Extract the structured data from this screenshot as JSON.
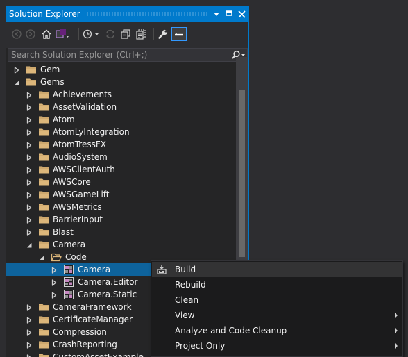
{
  "window": {
    "title": "Solution Explorer",
    "accent": "#007acc",
    "background": "#2d2d30"
  },
  "title_buttons": [
    {
      "name": "window-position-dropdown",
      "icon": "triangle-down-icon"
    },
    {
      "name": "pin-button",
      "icon": "pin-icon"
    },
    {
      "name": "close-button",
      "icon": "close-icon"
    }
  ],
  "toolbar": {
    "items": [
      "back-icon",
      "forward-icon",
      "home-icon",
      "switch-views-icon",
      "pending-changes-filter-icon",
      "sync-with-active-document-icon",
      "collapse-all-icon",
      "show-all-files-icon",
      "properties-icon",
      "preview-selected-items-icon"
    ]
  },
  "search": {
    "placeholder": "Search Solution Explorer (Ctrl+;)",
    "value": ""
  },
  "tree": [
    {
      "label": "Gem",
      "level": 0,
      "expanded": false,
      "type": "folder"
    },
    {
      "label": "Gems",
      "level": 0,
      "expanded": true,
      "type": "folder"
    },
    {
      "label": "Achievements",
      "level": 1,
      "expanded": false,
      "type": "folder"
    },
    {
      "label": "AssetValidation",
      "level": 1,
      "expanded": false,
      "type": "folder"
    },
    {
      "label": "Atom",
      "level": 1,
      "expanded": false,
      "type": "folder"
    },
    {
      "label": "AtomLyIntegration",
      "level": 1,
      "expanded": false,
      "type": "folder"
    },
    {
      "label": "AtomTressFX",
      "level": 1,
      "expanded": false,
      "type": "folder"
    },
    {
      "label": "AudioSystem",
      "level": 1,
      "expanded": false,
      "type": "folder"
    },
    {
      "label": "AWSClientAuth",
      "level": 1,
      "expanded": false,
      "type": "folder"
    },
    {
      "label": "AWSCore",
      "level": 1,
      "expanded": false,
      "type": "folder"
    },
    {
      "label": "AWSGameLift",
      "level": 1,
      "expanded": false,
      "type": "folder"
    },
    {
      "label": "AWSMetrics",
      "level": 1,
      "expanded": false,
      "type": "folder"
    },
    {
      "label": "BarrierInput",
      "level": 1,
      "expanded": false,
      "type": "folder"
    },
    {
      "label": "Blast",
      "level": 1,
      "expanded": false,
      "type": "folder"
    },
    {
      "label": "Camera",
      "level": 1,
      "expanded": true,
      "type": "folder"
    },
    {
      "label": "Code",
      "level": 2,
      "expanded": true,
      "type": "folder-open"
    },
    {
      "label": "Camera",
      "level": 3,
      "expanded": false,
      "type": "project",
      "selected": true
    },
    {
      "label": "Camera.Editor",
      "level": 3,
      "expanded": false,
      "type": "project"
    },
    {
      "label": "Camera.Static",
      "level": 3,
      "expanded": false,
      "type": "project"
    },
    {
      "label": "CameraFramework",
      "level": 1,
      "expanded": false,
      "type": "folder"
    },
    {
      "label": "CertificateManager",
      "level": 1,
      "expanded": false,
      "type": "folder"
    },
    {
      "label": "Compression",
      "level": 1,
      "expanded": false,
      "type": "folder"
    },
    {
      "label": "CrashReporting",
      "level": 1,
      "expanded": false,
      "type": "folder"
    },
    {
      "label": "CustomAssetExample",
      "level": 1,
      "expanded": false,
      "type": "folder"
    }
  ],
  "context_menu": {
    "items": [
      {
        "label": "Build",
        "icon": "build-icon",
        "submenu": false,
        "highlighted": true
      },
      {
        "label": "Rebuild",
        "submenu": false
      },
      {
        "label": "Clean",
        "submenu": false
      },
      {
        "label": "View",
        "submenu": true
      },
      {
        "label": "Analyze and Code Cleanup",
        "submenu": true
      },
      {
        "label": "Project Only",
        "submenu": true
      }
    ]
  },
  "colors": {
    "selection": "#0e639c",
    "folder": "#dcb67a",
    "menu_background": "#1b1b1c",
    "menu_highlight": "#333334"
  }
}
